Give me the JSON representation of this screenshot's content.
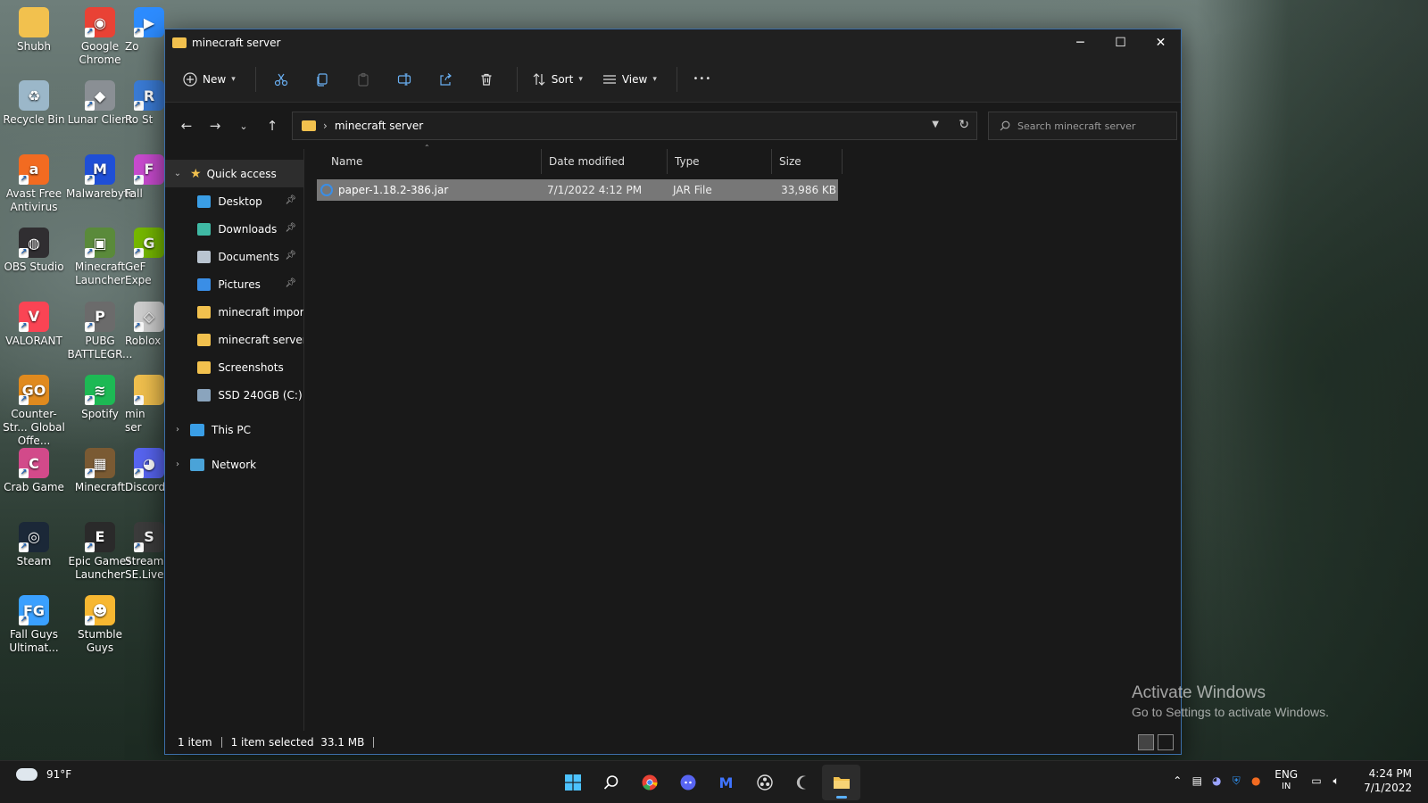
{
  "desktop": {
    "icons": [
      {
        "label": "Shubh",
        "color": "#f2c14e",
        "glyph": ""
      },
      {
        "label": "Google Chrome",
        "color": "#e94235",
        "glyph": "◉"
      },
      {
        "label": "Zo",
        "color": "#2d8cff",
        "glyph": "▶"
      },
      {
        "label": "Recycle Bin",
        "color": "#9bb7c9",
        "glyph": "♻"
      },
      {
        "label": "Lunar Client",
        "color": "#8a8f94",
        "glyph": "◆"
      },
      {
        "label": "Ro St",
        "color": "#3a7bd5",
        "glyph": "R"
      },
      {
        "label": "Avast Free Antivirus",
        "color": "#f26b21",
        "glyph": "a"
      },
      {
        "label": "Malwarebyte",
        "color": "#1f4fd6",
        "glyph": "M"
      },
      {
        "label": "Fall",
        "color": "#c94bd0",
        "glyph": "F"
      },
      {
        "label": "OBS Studio",
        "color": "#302e31",
        "glyph": "◍"
      },
      {
        "label": "Minecraft Launcher",
        "color": "#5a8a3a",
        "glyph": "▣"
      },
      {
        "label": "GeF Expe",
        "color": "#76b900",
        "glyph": "G"
      },
      {
        "label": "VALORANT",
        "color": "#fa4454",
        "glyph": "V"
      },
      {
        "label": "PUBG BATTLEGR...",
        "color": "#6b6b6b",
        "glyph": "P"
      },
      {
        "label": "Roblox",
        "color": "#d0d0d0",
        "glyph": "◇"
      },
      {
        "label": "Counter-Str... Global Offe...",
        "color": "#e08a1e",
        "glyph": "GO"
      },
      {
        "label": "Spotify",
        "color": "#1db954",
        "glyph": "≋"
      },
      {
        "label": "min ser",
        "color": "#f2c14e",
        "glyph": ""
      },
      {
        "label": "Crab Game",
        "color": "#d24a8a",
        "glyph": "C"
      },
      {
        "label": "Minecraft",
        "color": "#7a5a33",
        "glyph": "▦"
      },
      {
        "label": "Discord",
        "color": "#5865f2",
        "glyph": "◕"
      },
      {
        "label": "Steam",
        "color": "#1b2838",
        "glyph": "◎"
      },
      {
        "label": "Epic Games Launcher",
        "color": "#2a2a2a",
        "glyph": "E"
      },
      {
        "label": "StreamEle... SE.Live",
        "color": "#3c3c3c",
        "glyph": "S"
      },
      {
        "label": "Fall Guys Ultimat...",
        "color": "#3aa0ff",
        "glyph": "FG"
      },
      {
        "label": "Stumble Guys",
        "color": "#f7b731",
        "glyph": "☻"
      }
    ]
  },
  "window": {
    "title": "minecraft server",
    "controls": {
      "minimize": "─",
      "maximize": "☐",
      "close": "✕"
    }
  },
  "toolbar": {
    "new_label": "New",
    "sort_label": "Sort",
    "view_label": "View",
    "more": "•••"
  },
  "address": {
    "path": "minecraft server",
    "separator": "›",
    "search_placeholder": "Search minecraft server"
  },
  "nav": {
    "quick_access": "Quick access",
    "items": [
      {
        "label": "Desktop",
        "pinned": true,
        "color": "#3a9ee6"
      },
      {
        "label": "Downloads",
        "pinned": true,
        "color": "#3fb9a4"
      },
      {
        "label": "Documents",
        "pinned": true,
        "color": "#b9c4d0"
      },
      {
        "label": "Pictures",
        "pinned": true,
        "color": "#3a8ee6"
      },
      {
        "label": "minecraft importa",
        "pinned": false,
        "color": "#f2c14e"
      },
      {
        "label": "minecraft server",
        "pinned": false,
        "color": "#f2c14e"
      },
      {
        "label": "Screenshots",
        "pinned": false,
        "color": "#f2c14e"
      },
      {
        "label": "SSD 240GB (C:)",
        "pinned": false,
        "color": "#8aa4bd"
      }
    ],
    "this_pc": "This PC",
    "network": "Network"
  },
  "columns": {
    "name": "Name",
    "date": "Date modified",
    "type": "Type",
    "size": "Size"
  },
  "files": [
    {
      "name": "paper-1.18.2-386.jar",
      "date": "7/1/2022 4:12 PM",
      "type": "JAR File",
      "size": "33,986 KB"
    }
  ],
  "status": {
    "count": "1 item",
    "selected": "1 item selected  33.1 MB"
  },
  "watermark": {
    "line1": "Activate Windows",
    "line2": "Go to Settings to activate Windows."
  },
  "taskbar": {
    "temperature": "91°F",
    "lang": "ENG",
    "lang2": "IN",
    "time": "4:24 PM",
    "date": "7/1/2022"
  }
}
